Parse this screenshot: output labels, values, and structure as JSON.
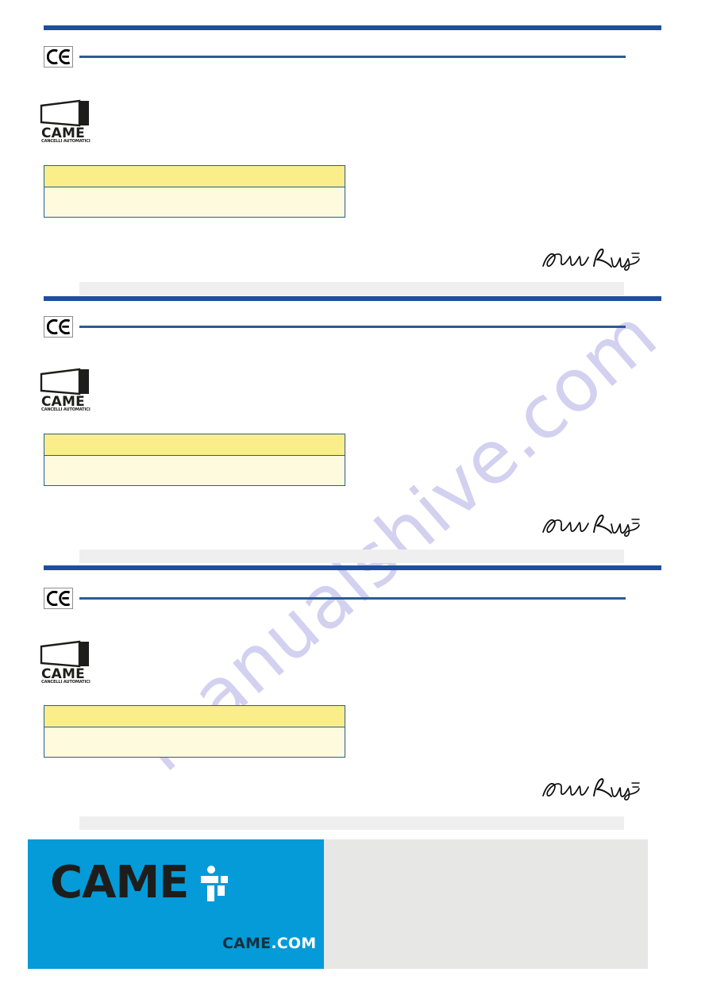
{
  "document": {
    "type": "declaration-of-conformity",
    "watermark": "manualshive.com",
    "page_background": "#ffffff"
  },
  "colors": {
    "rule_blue": "#1f4e9c",
    "line_blue": "#2a5c96",
    "gray_band": "#efefef",
    "table_header_yellow": "#f9ee8a",
    "table_body_yellow": "#fdfade",
    "footer_cyan": "#049bd8",
    "footer_gray": "#e7e7e5",
    "logo_black": "#1d1d1b",
    "watermark_purple": "#b9b5e8"
  },
  "sections": [
    {
      "id": "section-1",
      "ce_mark_label": "CE",
      "logo": {
        "wordmark": "CAME",
        "tagline": "CANCELLI AUTOMATICI"
      },
      "table": {
        "header_row": "",
        "body_row": ""
      },
      "signature_present": true
    },
    {
      "id": "section-2",
      "ce_mark_label": "CE",
      "logo": {
        "wordmark": "CAME",
        "tagline": "CANCELLI AUTOMATICI"
      },
      "table": {
        "header_row": "",
        "body_row": ""
      },
      "signature_present": true
    },
    {
      "id": "section-3",
      "ce_mark_label": "CE",
      "logo": {
        "wordmark": "CAME",
        "tagline": "CANCELLI AUTOMATICI"
      },
      "table": {
        "header_row": "",
        "body_row": ""
      },
      "signature_present": true
    }
  ],
  "footer": {
    "wordmark": "CAME",
    "icon": "came-gate-figure-icon",
    "url_name": "CAME",
    "url_tld": ".COM"
  }
}
